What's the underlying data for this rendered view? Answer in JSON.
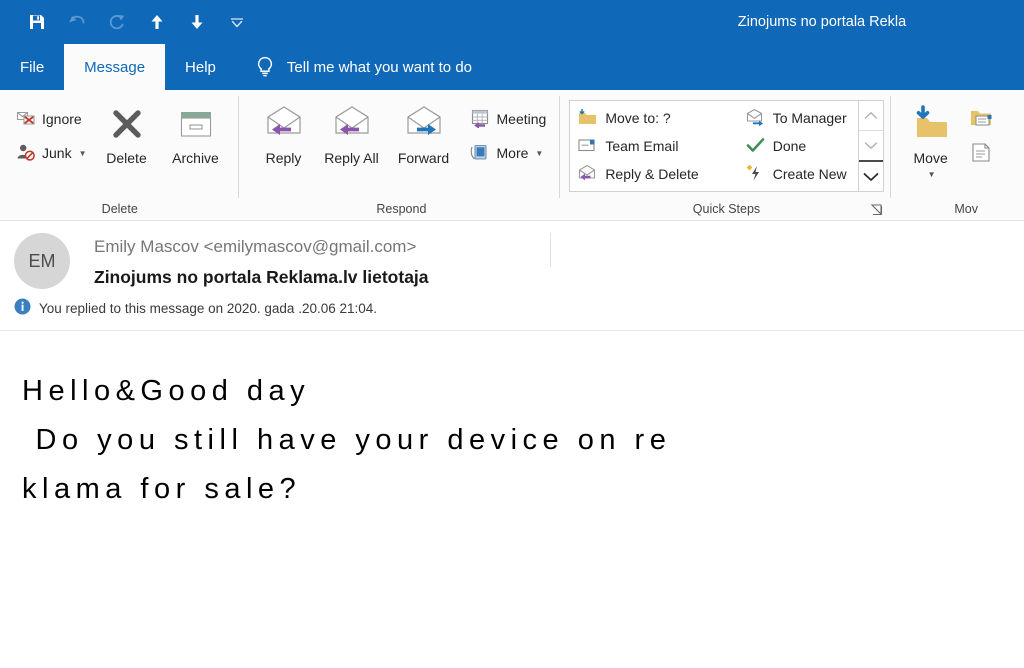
{
  "window": {
    "title": "Zinojums no portala Rekla",
    "accent_color": "#1068B8",
    "ribbon_bg": "#fbfbfb"
  },
  "quick_access_toolbar": {
    "items": [
      {
        "name": "save-icon",
        "label": "Save",
        "enabled": true
      },
      {
        "name": "undo-icon",
        "label": "Undo",
        "enabled": false
      },
      {
        "name": "redo-icon",
        "label": "Redo",
        "enabled": false
      },
      {
        "name": "previous-item-icon",
        "label": "Previous Item",
        "enabled": true
      },
      {
        "name": "next-item-icon",
        "label": "Next Item",
        "enabled": true
      },
      {
        "name": "customize-quick-access-toolbar-icon",
        "label": "Customize Quick Access Toolbar",
        "enabled": true
      }
    ]
  },
  "tabs": [
    {
      "label": "File",
      "active": false
    },
    {
      "label": "Message",
      "active": true
    },
    {
      "label": "Help",
      "active": false
    }
  ],
  "tell_me": {
    "icon": "lightbulb-icon",
    "placeholder": "Tell me what you want to do"
  },
  "ribbon": {
    "groups": [
      {
        "label": "Delete",
        "small_buttons": [
          {
            "label": "Ignore",
            "icon": "ignore-icon",
            "has_caret": false
          },
          {
            "label": "Junk",
            "icon": "junk-icon",
            "has_caret": true
          }
        ],
        "large_buttons": [
          {
            "label": "Delete",
            "icon": "delete-x-icon"
          },
          {
            "label": "Archive",
            "icon": "archive-box-icon"
          }
        ]
      },
      {
        "label": "Respond",
        "large_buttons": [
          {
            "label": "Reply",
            "icon": "reply-envelope-icon"
          },
          {
            "label": "Reply All",
            "icon": "reply-all-envelope-icon"
          },
          {
            "label": "Forward",
            "icon": "forward-envelope-icon"
          }
        ],
        "small_buttons": [
          {
            "label": "Meeting",
            "icon": "meeting-calendar-icon",
            "has_caret": false
          },
          {
            "label": "More",
            "icon": "more-device-icon",
            "has_caret": true
          }
        ]
      },
      {
        "label": "Quick Steps",
        "gallery": {
          "column_one": [
            {
              "label": "Move to: ?",
              "icon": "move-to-folder-icon"
            },
            {
              "label": "Team Email",
              "icon": "team-email-icon"
            },
            {
              "label": "Reply & Delete",
              "icon": "reply-and-delete-icon"
            }
          ],
          "column_two": [
            {
              "label": "To Manager",
              "icon": "to-manager-icon"
            },
            {
              "label": "Done",
              "icon": "done-check-icon"
            },
            {
              "label": "Create New",
              "icon": "create-new-icon"
            }
          ],
          "scroll": [
            {
              "name": "scroll-up-icon",
              "enabled": false
            },
            {
              "name": "scroll-down-icon",
              "enabled": false
            },
            {
              "name": "more-gallery-icon",
              "enabled": true
            }
          ]
        },
        "dialog_launcher": "quick-steps-dialog-launcher-icon"
      },
      {
        "label": "Mov",
        "large_buttons": [
          {
            "label": "Move",
            "icon": "move-folder-icon",
            "has_caret": true
          }
        ],
        "small_buttons": [
          {
            "label": "",
            "icon": "rules-icon",
            "has_caret": false
          },
          {
            "label": "",
            "icon": "onenote-actions-icon",
            "has_caret": false
          }
        ]
      }
    ]
  },
  "message": {
    "avatar_initials": "EM",
    "sender": "Emily Mascov <emilymascov@gmail.com>",
    "subject": "Zinojums no portala Reklama.lv lietotaja",
    "info_icon": "info-circle-icon",
    "info_text": "You replied to this message on 2020.  gada .20.06 21:04.",
    "body_lines": [
      "Hello&Good day",
      " Do you still have your device on re",
      "klama for sale?"
    ]
  }
}
